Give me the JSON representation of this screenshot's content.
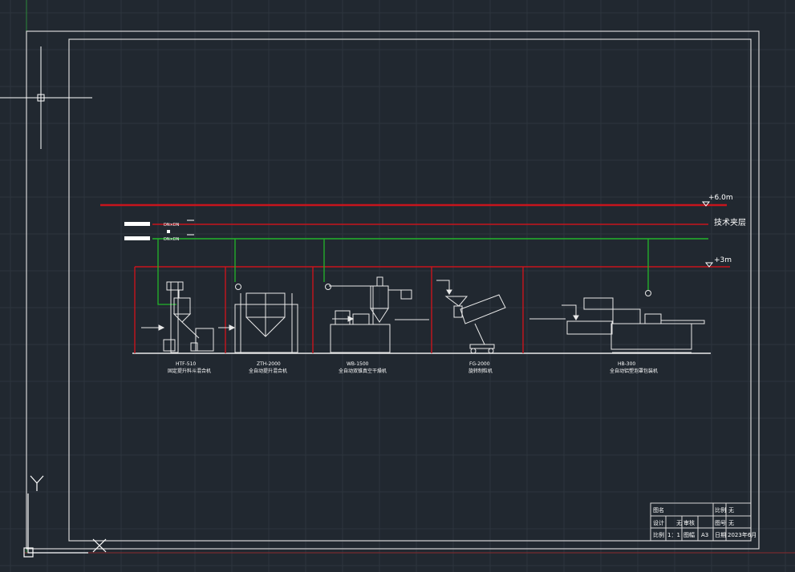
{
  "levels": {
    "top": "+6.0m",
    "interlayer": "技术夹层",
    "floor": "+3m"
  },
  "valve_tags": [
    "DN×DN",
    "DN×DN"
  ],
  "machines": [
    {
      "model": "HTF-510",
      "name": "固定提升料斗混合机"
    },
    {
      "model": "ZTH-2000",
      "name": "全自动提升混合机"
    },
    {
      "model": "WB-1500",
      "name": "全自动双锥真空干燥机"
    },
    {
      "model": "FG-2000",
      "name": "旋转制粒机"
    },
    {
      "model": "HB-300",
      "name": "全自动铝塑泡罩包装机"
    }
  ],
  "title_block": {
    "row1": {
      "left": "图名",
      "mid_label": "比例",
      "mid_value": "无"
    },
    "row2": {
      "l1": "设计",
      "v1": "无",
      "l2": "审核",
      "v2": "",
      "l3": "图号",
      "v3": "无"
    },
    "row3": {
      "l1": "比例",
      "v1": "1：1",
      "l2": "图幅",
      "v2": "A3",
      "l3": "日期",
      "v3": "2023年6月"
    }
  },
  "ucs": {
    "y": "Y",
    "x": "X"
  },
  "colors": {
    "bg": "#212830",
    "grid": "#2d353e",
    "red": "#c8141c",
    "green": "#22b52a",
    "white": "#e9e9e9"
  }
}
